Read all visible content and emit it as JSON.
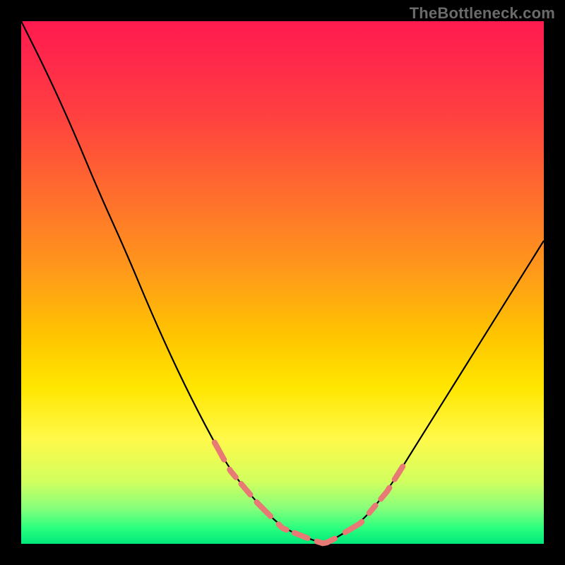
{
  "watermark": "TheBottleneck.com",
  "colors": {
    "frame": "#000000",
    "curve": "#000000",
    "highlight": "#e77a74"
  },
  "chart_data": {
    "type": "line",
    "title": "",
    "xlabel": "",
    "ylabel": "",
    "xlim": [
      0,
      100
    ],
    "ylim": [
      0,
      100
    ],
    "grid": false,
    "legend": false,
    "x": [
      0,
      5,
      10,
      15,
      20,
      25,
      30,
      35,
      40,
      45,
      50,
      55,
      58,
      60,
      65,
      70,
      75,
      80,
      85,
      90,
      95,
      100
    ],
    "y": [
      100,
      90,
      79,
      67,
      56,
      44,
      33,
      23,
      14,
      8,
      3,
      1,
      0,
      1,
      4,
      10,
      18,
      26,
      34,
      42,
      50,
      58
    ],
    "highlight_segments": [
      {
        "x_range": [
          37,
          60
        ],
        "side": "left"
      },
      {
        "x_range": [
          62,
          73
        ],
        "side": "right"
      }
    ],
    "note": "V-shaped curve over vertical rainbow gradient; salmon dashed overlay near the minimum on both branches."
  }
}
